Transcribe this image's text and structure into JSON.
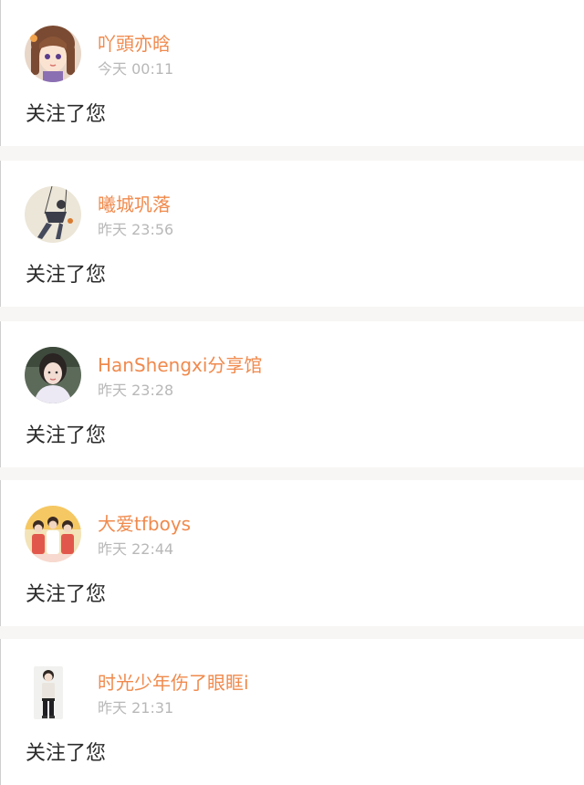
{
  "notifications": [
    {
      "username": "吖頭亦晗",
      "day": "今天",
      "time": "00:11",
      "message": "关注了您",
      "avatar": "anime-girl-avatar"
    },
    {
      "username": "曦城巩落",
      "day": "昨天",
      "time": "23:56",
      "message": "关注了您",
      "avatar": "figure-on-swing-avatar"
    },
    {
      "username": "HanShengxi分享馆",
      "day": "昨天",
      "time": "23:28",
      "message": "关注了您",
      "avatar": "portrait-photo-avatar"
    },
    {
      "username": "大爱tfboys",
      "day": "昨天",
      "time": "22:44",
      "message": "关注了您",
      "avatar": "group-photo-avatar"
    },
    {
      "username": "时光少年伤了眼眶i",
      "day": "昨天",
      "time": "21:31",
      "message": "关注了您",
      "avatar": "standing-boy-avatar"
    }
  ],
  "colors": {
    "username": "#f08a4d",
    "timestamp": "#b8b8b8",
    "message": "#2b2b2b",
    "divider": "#f7f6f5"
  }
}
